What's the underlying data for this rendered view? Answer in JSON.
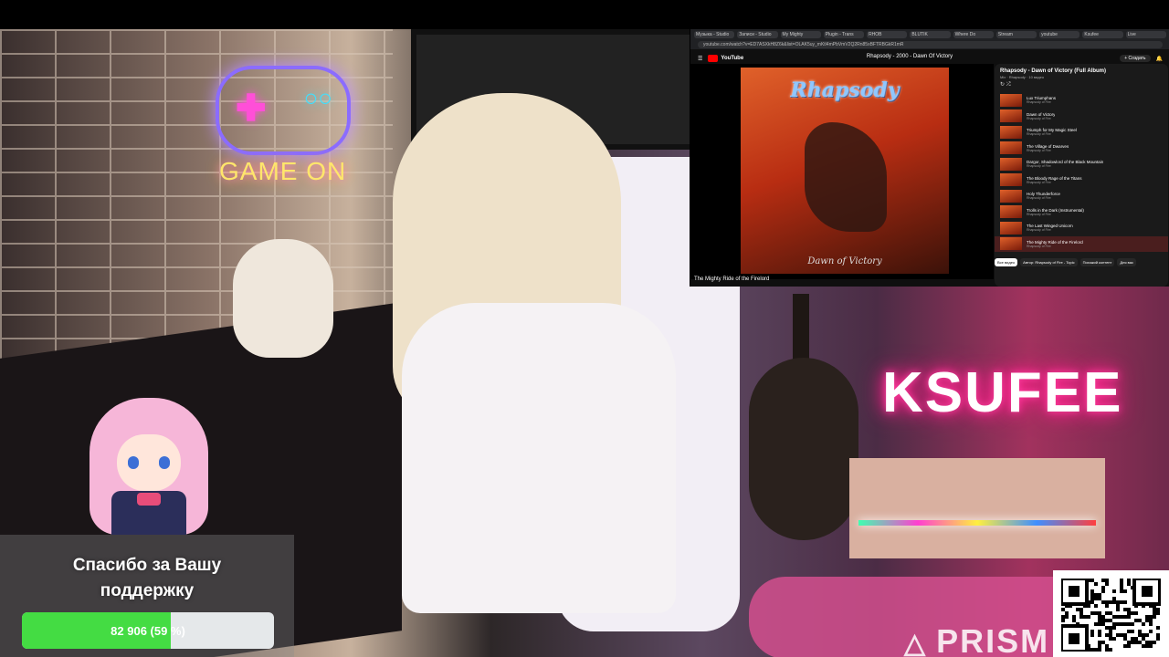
{
  "scene": {
    "neon_sign_left": "GAME ON",
    "neon_sign_right": "KSUFEE",
    "watermark": "PRISM"
  },
  "youtube": {
    "browser_tabs": [
      "Музыка - Studio",
      "Записи - Studio",
      "My Mighty",
      "Plugin - Trans",
      "RHOB",
      "BLUTIK",
      "Where Do",
      "Stream",
      "youtube",
      "Ksufee",
      "Live"
    ],
    "address": "youtube.com/watch?v=ED7ASXkH8Z6k&list=OLAK5uy_mKtl4mPbVmV2Q2Rn85xBFTRBGkR1mR",
    "logo_text": "YouTube",
    "create_label": "+ Создать",
    "video_title": "Rhapsody - 2000 - Dawn Of Victory",
    "album_logo": "Rhapsody",
    "album_subtitle": "Dawn of Victory",
    "now_playing_caption": "The Mighty Ride of the Firelord",
    "playlist_title": "Rhapsody - Dawn of Victory (Full Album)",
    "playlist_sub": "Mix · Rhapsody · 10 видео",
    "playlist_controls": "↻   ⤮",
    "playlist": [
      {
        "name": "Lux Triumphans",
        "artist": "Rhapsody of Fire"
      },
      {
        "name": "Dawn of Victory",
        "artist": "Rhapsody of Fire"
      },
      {
        "name": "Triumph for My Magic Steel",
        "artist": "Rhapsody of Fire"
      },
      {
        "name": "The Village of Dwarves",
        "artist": "Rhapsody of Fire"
      },
      {
        "name": "Dargor, Shadowlord of the Black Mountain",
        "artist": "Rhapsody of Fire"
      },
      {
        "name": "The Bloody Rage of the Titans",
        "artist": "Rhapsody of Fire"
      },
      {
        "name": "Holy Thunderforce",
        "artist": "Rhapsody of Fire"
      },
      {
        "name": "Trolls in the Dark (Instrumental)",
        "artist": "Rhapsody of Fire"
      },
      {
        "name": "The Last Winged Unicorn",
        "artist": "Rhapsody of Fire"
      },
      {
        "name": "The Mighty Ride of the Firelord",
        "artist": "Rhapsody of Fire"
      }
    ],
    "active_index": 9,
    "chips": [
      "Все видео",
      "Автор: Rhapsody of Fire - Topic",
      "Похожий контент",
      "Для вас"
    ]
  },
  "donation": {
    "message_line1": "Спасибо за Вашу",
    "message_line2": "поддержку",
    "progress_label": "82 906 (59 %)",
    "progress_percent": 59,
    "fill_color": "#44dc43"
  }
}
